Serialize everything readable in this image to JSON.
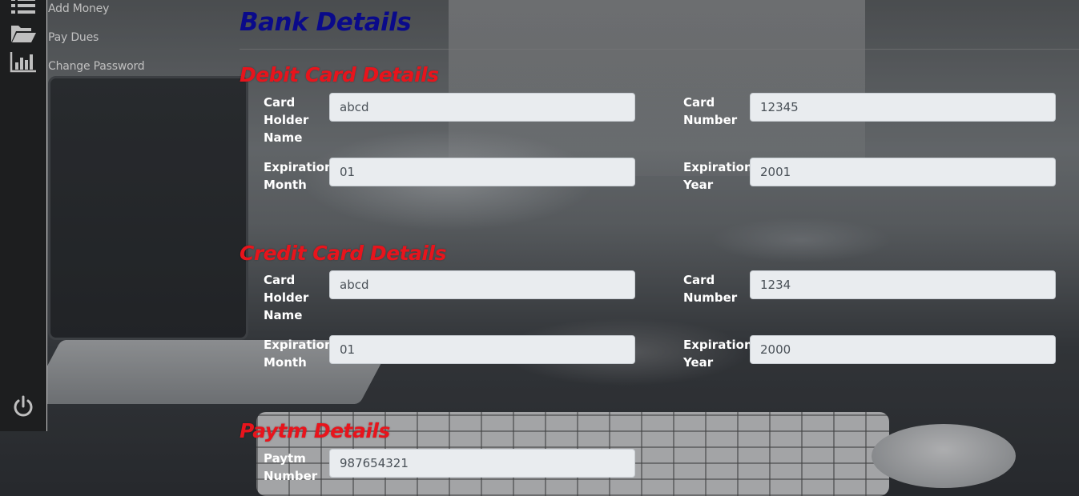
{
  "sidebar": {
    "items": [
      {
        "icon": "list-icon",
        "label": "Add Money"
      },
      {
        "icon": "folder-open-icon",
        "label": "Pay Dues"
      },
      {
        "icon": "bar-chart-icon",
        "label": "Change Password"
      }
    ],
    "logout_icon": "power-icon"
  },
  "page": {
    "title": "Bank Details"
  },
  "debit": {
    "title": "Debit Card Details",
    "holder_label": "Card Holder Name",
    "holder_value": "abcd",
    "number_label": "Card Number",
    "number_value": "12345",
    "month_label": "Expiration Month",
    "month_value": "01",
    "year_label": "Expiration Year",
    "year_value": "2001"
  },
  "credit": {
    "title": "Credit Card Details",
    "holder_label": "Card Holder Name",
    "holder_value": "abcd",
    "number_label": "Card Number",
    "number_value": "1234",
    "month_label": "Expiration Month",
    "month_value": "01",
    "year_label": "Expiration Year",
    "year_value": "2000"
  },
  "paytm": {
    "title": "Paytm Details",
    "number_label": "Paytm Number",
    "number_value": "987654321"
  },
  "colors": {
    "page_title": "#0a0a8a",
    "section_title": "#e8141c",
    "sidebar_bg": "#1d1e1f"
  }
}
